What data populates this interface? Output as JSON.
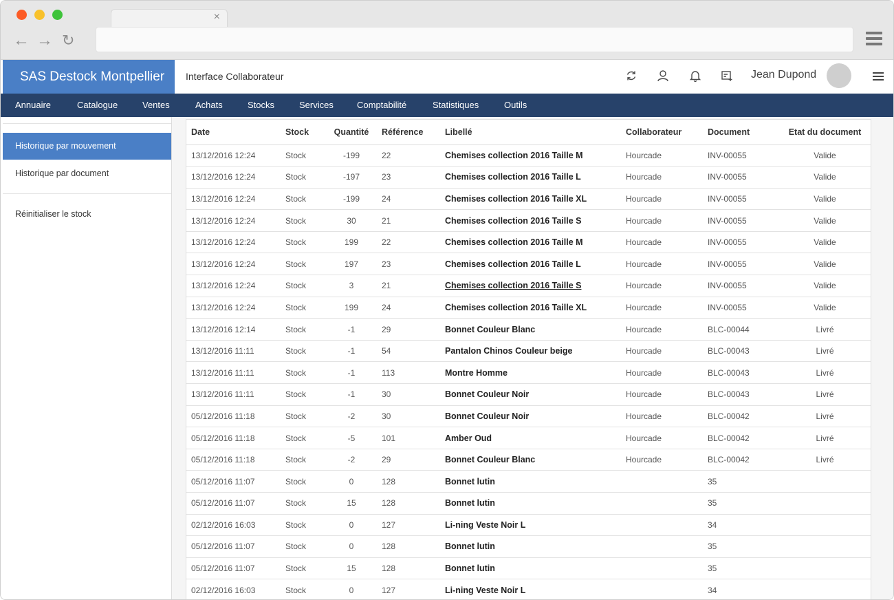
{
  "browser": {
    "tab_close": "×"
  },
  "header": {
    "brand": "SAS Destock Montpellier",
    "subtitle": "Interface Collaborateur",
    "user_name": "Jean Dupond",
    "icons": [
      "refresh-icon",
      "users-icon",
      "bell-icon",
      "add-note-icon",
      "menu-icon"
    ]
  },
  "nav": {
    "items": [
      "Annuaire",
      "Catalogue",
      "Ventes",
      "Achats",
      "Stocks",
      "Services",
      "Comptabilité",
      "Statistiques",
      "Outils"
    ]
  },
  "sidebar": {
    "items": [
      "Historique par mouvement",
      "Historique par document",
      "Réinitialiser le stock"
    ],
    "active_index": 0
  },
  "table": {
    "columns": [
      "Date",
      "Stock",
      "Quantité",
      "Référence",
      "Libellé",
      "Collaborateur",
      "Document",
      "Etat du document"
    ],
    "rows": [
      [
        "13/12/2016 12:24",
        "Stock",
        "-199",
        "22",
        "Chemises collection 2016 Taille M",
        "Hourcade",
        "INV-00055",
        "Valide"
      ],
      [
        "13/12/2016 12:24",
        "Stock",
        "-197",
        "23",
        "Chemises collection 2016 Taille L",
        "Hourcade",
        "INV-00055",
        "Valide"
      ],
      [
        "13/12/2016 12:24",
        "Stock",
        "-199",
        "24",
        "Chemises collection 2016 Taille XL",
        "Hourcade",
        "INV-00055",
        "Valide"
      ],
      [
        "13/12/2016 12:24",
        "Stock",
        "30",
        "21",
        "Chemises collection 2016 Taille S",
        "Hourcade",
        "INV-00055",
        "Valide"
      ],
      [
        "13/12/2016 12:24",
        "Stock",
        "199",
        "22",
        "Chemises collection 2016 Taille M",
        "Hourcade",
        "INV-00055",
        "Valide"
      ],
      [
        "13/12/2016 12:24",
        "Stock",
        "197",
        "23",
        "Chemises collection 2016 Taille L",
        "Hourcade",
        "INV-00055",
        "Valide"
      ],
      [
        "13/12/2016 12:24",
        "Stock",
        "3",
        "21",
        "Chemises collection 2016 Taille S",
        "Hourcade",
        "INV-00055",
        "Valide"
      ],
      [
        "13/12/2016 12:24",
        "Stock",
        "199",
        "24",
        "Chemises collection 2016 Taille XL",
        "Hourcade",
        "INV-00055",
        "Valide"
      ],
      [
        "13/12/2016 12:14",
        "Stock",
        "-1",
        "29",
        "Bonnet Couleur Blanc",
        "Hourcade",
        "BLC-00044",
        "Livré"
      ],
      [
        "13/12/2016 11:11",
        "Stock",
        "-1",
        "54",
        "Pantalon Chinos Couleur beige",
        "Hourcade",
        "BLC-00043",
        "Livré"
      ],
      [
        "13/12/2016 11:11",
        "Stock",
        "-1",
        "113",
        "Montre Homme",
        "Hourcade",
        "BLC-00043",
        "Livré"
      ],
      [
        "13/12/2016 11:11",
        "Stock",
        "-1",
        "30",
        "Bonnet Couleur Noir",
        "Hourcade",
        "BLC-00043",
        "Livré"
      ],
      [
        "05/12/2016 11:18",
        "Stock",
        "-2",
        "30",
        "Bonnet Couleur Noir",
        "Hourcade",
        "BLC-00042",
        "Livré"
      ],
      [
        "05/12/2016 11:18",
        "Stock",
        "-5",
        "101",
        "Amber Oud",
        "Hourcade",
        "BLC-00042",
        "Livré"
      ],
      [
        "05/12/2016 11:18",
        "Stock",
        "-2",
        "29",
        "Bonnet Couleur Blanc",
        "Hourcade",
        "BLC-00042",
        "Livré"
      ],
      [
        "05/12/2016 11:07",
        "Stock",
        "0",
        "128",
        "Bonnet lutin",
        "",
        "35",
        ""
      ],
      [
        "05/12/2016 11:07",
        "Stock",
        "15",
        "128",
        "Bonnet lutin",
        "",
        "35",
        ""
      ],
      [
        "02/12/2016 16:03",
        "Stock",
        "0",
        "127",
        "Li-ning Veste Noir L",
        "",
        "34",
        ""
      ],
      [
        "05/12/2016 11:07",
        "Stock",
        "0",
        "128",
        "Bonnet lutin",
        "",
        "35",
        ""
      ],
      [
        "05/12/2016 11:07",
        "Stock",
        "15",
        "128",
        "Bonnet lutin",
        "",
        "35",
        ""
      ],
      [
        "02/12/2016 16:03",
        "Stock",
        "0",
        "127",
        "Li-ning Veste Noir L",
        "",
        "34",
        ""
      ]
    ],
    "underlined_row_index": 6
  },
  "colors": {
    "brand_blue": "#4a7fc6",
    "nav_navy": "#27426a"
  }
}
